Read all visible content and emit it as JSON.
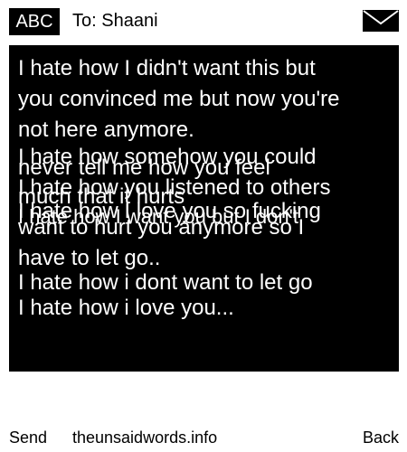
{
  "header": {
    "badge_label": "ABC",
    "recipient": "To: Shaani",
    "icon": "envelope-icon"
  },
  "message": {
    "lines": [
      "I hate how I didn't want this but",
      "you convinced me but now you're",
      "not here anymore.",
      "I hate how somehow you could",
      "never tell me how you feel",
      "I hate how you listened to others",
      "much that it hurts",
      "I hate how I love you so fucking",
      "want to hurt you anymore so I",
      "I hate how I want you but I don't",
      "have to let go..",
      "I hate how i dont want to let go",
      "I hate how i love you..."
    ]
  },
  "footer": {
    "send_label": "Send",
    "site_label": "theunsaidwords.info",
    "back_label": "Back"
  },
  "colors": {
    "background": "#ffffff",
    "message_bg": "#000000",
    "message_text": "#ffffff"
  }
}
